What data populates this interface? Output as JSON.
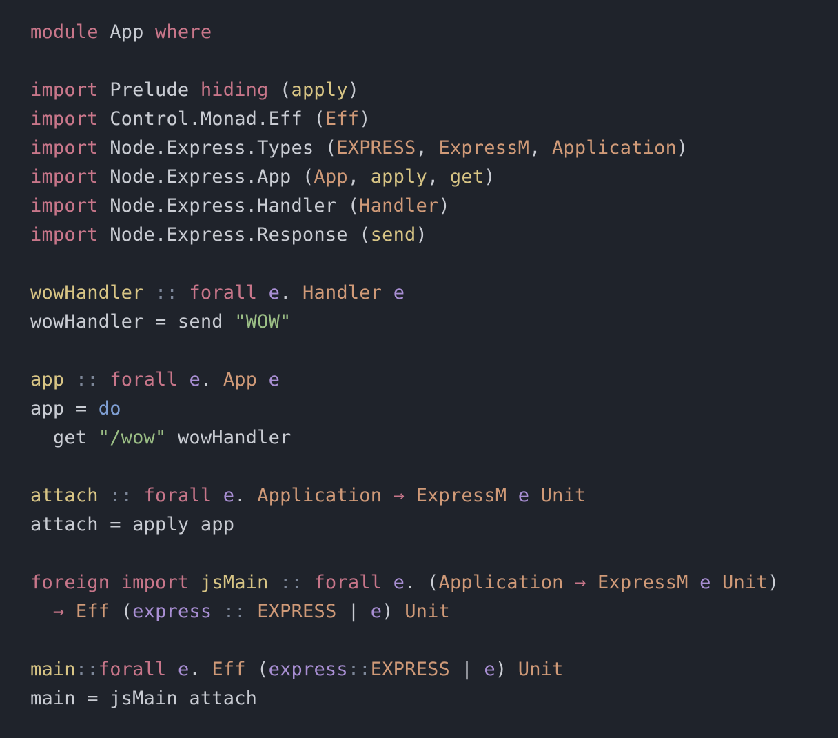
{
  "editor": {
    "background": "#1f232b",
    "language": "PureScript",
    "lines": [
      [
        {
          "t": "module",
          "c": "kw"
        },
        {
          "t": " App ",
          "c": "plain"
        },
        {
          "t": "where",
          "c": "kw"
        }
      ],
      [],
      [
        {
          "t": "import",
          "c": "kw"
        },
        {
          "t": " Prelude ",
          "c": "plain"
        },
        {
          "t": "hiding",
          "c": "kw"
        },
        {
          "t": " (",
          "c": "punc"
        },
        {
          "t": "apply",
          "c": "fn"
        },
        {
          "t": ")",
          "c": "punc"
        }
      ],
      [
        {
          "t": "import",
          "c": "kw"
        },
        {
          "t": " Control.Monad.Eff ",
          "c": "plain"
        },
        {
          "t": "(",
          "c": "punc"
        },
        {
          "t": "Eff",
          "c": "type"
        },
        {
          "t": ")",
          "c": "punc"
        }
      ],
      [
        {
          "t": "import",
          "c": "kw"
        },
        {
          "t": " Node.Express.Types ",
          "c": "plain"
        },
        {
          "t": "(",
          "c": "punc"
        },
        {
          "t": "EXPRESS",
          "c": "type"
        },
        {
          "t": ", ",
          "c": "punc"
        },
        {
          "t": "ExpressM",
          "c": "type"
        },
        {
          "t": ", ",
          "c": "punc"
        },
        {
          "t": "Application",
          "c": "type"
        },
        {
          "t": ")",
          "c": "punc"
        }
      ],
      [
        {
          "t": "import",
          "c": "kw"
        },
        {
          "t": " Node.Express.App ",
          "c": "plain"
        },
        {
          "t": "(",
          "c": "punc"
        },
        {
          "t": "App",
          "c": "type"
        },
        {
          "t": ", ",
          "c": "punc"
        },
        {
          "t": "apply",
          "c": "fn"
        },
        {
          "t": ", ",
          "c": "punc"
        },
        {
          "t": "get",
          "c": "fn"
        },
        {
          "t": ")",
          "c": "punc"
        }
      ],
      [
        {
          "t": "import",
          "c": "kw"
        },
        {
          "t": " Node.Express.Handler ",
          "c": "plain"
        },
        {
          "t": "(",
          "c": "punc"
        },
        {
          "t": "Handler",
          "c": "type"
        },
        {
          "t": ")",
          "c": "punc"
        }
      ],
      [
        {
          "t": "import",
          "c": "kw"
        },
        {
          "t": " Node.Express.Response ",
          "c": "plain"
        },
        {
          "t": "(",
          "c": "punc"
        },
        {
          "t": "send",
          "c": "fn"
        },
        {
          "t": ")",
          "c": "punc"
        }
      ],
      [],
      [
        {
          "t": "wowHandler",
          "c": "fn"
        },
        {
          "t": " ",
          "c": "plain"
        },
        {
          "t": "::",
          "c": "dim"
        },
        {
          "t": " ",
          "c": "plain"
        },
        {
          "t": "forall",
          "c": "kw"
        },
        {
          "t": " ",
          "c": "plain"
        },
        {
          "t": "e",
          "c": "var"
        },
        {
          "t": ". ",
          "c": "plain"
        },
        {
          "t": "Handler",
          "c": "type"
        },
        {
          "t": " ",
          "c": "plain"
        },
        {
          "t": "e",
          "c": "var"
        }
      ],
      [
        {
          "t": "wowHandler = send ",
          "c": "plain"
        },
        {
          "t": "\"WOW\"",
          "c": "str"
        }
      ],
      [],
      [
        {
          "t": "app",
          "c": "fn"
        },
        {
          "t": " ",
          "c": "plain"
        },
        {
          "t": "::",
          "c": "dim"
        },
        {
          "t": " ",
          "c": "plain"
        },
        {
          "t": "forall",
          "c": "kw"
        },
        {
          "t": " ",
          "c": "plain"
        },
        {
          "t": "e",
          "c": "var"
        },
        {
          "t": ". ",
          "c": "plain"
        },
        {
          "t": "App",
          "c": "type"
        },
        {
          "t": " ",
          "c": "plain"
        },
        {
          "t": "e",
          "c": "var"
        }
      ],
      [
        {
          "t": "app = ",
          "c": "plain"
        },
        {
          "t": "do",
          "c": "do"
        }
      ],
      [
        {
          "t": "  get ",
          "c": "plain"
        },
        {
          "t": "\"/wow\"",
          "c": "str"
        },
        {
          "t": " wowHandler",
          "c": "plain"
        }
      ],
      [],
      [
        {
          "t": "attach",
          "c": "fn"
        },
        {
          "t": " ",
          "c": "plain"
        },
        {
          "t": "::",
          "c": "dim"
        },
        {
          "t": " ",
          "c": "plain"
        },
        {
          "t": "forall",
          "c": "kw"
        },
        {
          "t": " ",
          "c": "plain"
        },
        {
          "t": "e",
          "c": "var"
        },
        {
          "t": ". ",
          "c": "plain"
        },
        {
          "t": "Application",
          "c": "type"
        },
        {
          "t": " ",
          "c": "plain"
        },
        {
          "t": "→",
          "c": "kw"
        },
        {
          "t": " ",
          "c": "plain"
        },
        {
          "t": "ExpressM",
          "c": "type"
        },
        {
          "t": " ",
          "c": "plain"
        },
        {
          "t": "e",
          "c": "var"
        },
        {
          "t": " ",
          "c": "plain"
        },
        {
          "t": "Unit",
          "c": "type"
        }
      ],
      [
        {
          "t": "attach = apply app",
          "c": "plain"
        }
      ],
      [],
      [
        {
          "t": "foreign",
          "c": "kw"
        },
        {
          "t": " ",
          "c": "plain"
        },
        {
          "t": "import",
          "c": "kw"
        },
        {
          "t": " ",
          "c": "plain"
        },
        {
          "t": "jsMain",
          "c": "fn"
        },
        {
          "t": " ",
          "c": "plain"
        },
        {
          "t": "::",
          "c": "dim"
        },
        {
          "t": " ",
          "c": "plain"
        },
        {
          "t": "forall",
          "c": "kw"
        },
        {
          "t": " ",
          "c": "plain"
        },
        {
          "t": "e",
          "c": "var"
        },
        {
          "t": ". (",
          "c": "plain"
        },
        {
          "t": "Application",
          "c": "type"
        },
        {
          "t": " ",
          "c": "plain"
        },
        {
          "t": "→",
          "c": "kw"
        },
        {
          "t": " ",
          "c": "plain"
        },
        {
          "t": "ExpressM",
          "c": "type"
        },
        {
          "t": " ",
          "c": "plain"
        },
        {
          "t": "e",
          "c": "var"
        },
        {
          "t": " ",
          "c": "plain"
        },
        {
          "t": "Unit",
          "c": "type"
        },
        {
          "t": ")",
          "c": "punc"
        }
      ],
      [
        {
          "t": "  ",
          "c": "plain"
        },
        {
          "t": "→",
          "c": "kw"
        },
        {
          "t": " ",
          "c": "plain"
        },
        {
          "t": "Eff",
          "c": "type"
        },
        {
          "t": " (",
          "c": "plain"
        },
        {
          "t": "express",
          "c": "var"
        },
        {
          "t": " ",
          "c": "plain"
        },
        {
          "t": "::",
          "c": "dim"
        },
        {
          "t": " ",
          "c": "plain"
        },
        {
          "t": "EXPRESS",
          "c": "type"
        },
        {
          "t": " | ",
          "c": "plain"
        },
        {
          "t": "e",
          "c": "var"
        },
        {
          "t": ") ",
          "c": "plain"
        },
        {
          "t": "Unit",
          "c": "type"
        }
      ],
      [],
      [
        {
          "t": "main",
          "c": "fn"
        },
        {
          "t": "::",
          "c": "dim"
        },
        {
          "t": "forall",
          "c": "kw"
        },
        {
          "t": " ",
          "c": "plain"
        },
        {
          "t": "e",
          "c": "var"
        },
        {
          "t": ". ",
          "c": "plain"
        },
        {
          "t": "Eff",
          "c": "type"
        },
        {
          "t": " (",
          "c": "plain"
        },
        {
          "t": "express",
          "c": "var"
        },
        {
          "t": "::",
          "c": "dim"
        },
        {
          "t": "EXPRESS",
          "c": "type"
        },
        {
          "t": " | ",
          "c": "plain"
        },
        {
          "t": "e",
          "c": "var"
        },
        {
          "t": ") ",
          "c": "plain"
        },
        {
          "t": "Unit",
          "c": "type"
        }
      ],
      [
        {
          "t": "main = jsMain attach",
          "c": "plain"
        }
      ]
    ]
  }
}
